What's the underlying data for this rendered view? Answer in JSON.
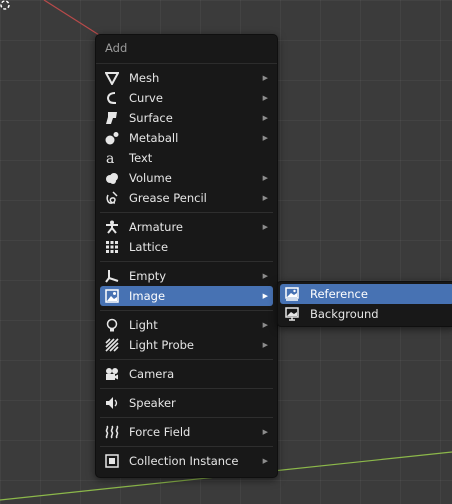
{
  "viewport": {
    "background_color": "#3b3b3b",
    "x_axis_color": "#b84a4a",
    "y_axis_color": "#8cb84a"
  },
  "add_menu": {
    "title": "Add",
    "items": [
      {
        "label": "Mesh",
        "icon": "mesh-icon",
        "submenu": true
      },
      {
        "label": "Curve",
        "icon": "curve-icon",
        "submenu": true
      },
      {
        "label": "Surface",
        "icon": "surface-icon",
        "submenu": true
      },
      {
        "label": "Metaball",
        "icon": "metaball-icon",
        "submenu": true
      },
      {
        "label": "Text",
        "icon": "text-icon",
        "submenu": false
      },
      {
        "label": "Volume",
        "icon": "volume-icon",
        "submenu": true
      },
      {
        "label": "Grease Pencil",
        "icon": "grease-pencil-icon",
        "submenu": true
      },
      {
        "label": "Armature",
        "icon": "armature-icon",
        "submenu": true
      },
      {
        "label": "Lattice",
        "icon": "lattice-icon",
        "submenu": false
      },
      {
        "label": "Empty",
        "icon": "empty-icon",
        "submenu": true
      },
      {
        "label": "Image",
        "icon": "image-icon",
        "submenu": true,
        "active": true
      },
      {
        "label": "Light",
        "icon": "light-icon",
        "submenu": true
      },
      {
        "label": "Light Probe",
        "icon": "light-probe-icon",
        "submenu": true
      },
      {
        "label": "Camera",
        "icon": "camera-icon",
        "submenu": false
      },
      {
        "label": "Speaker",
        "icon": "speaker-icon",
        "submenu": false
      },
      {
        "label": "Force Field",
        "icon": "force-field-icon",
        "submenu": true
      },
      {
        "label": "Collection Instance",
        "icon": "collection-instance-icon",
        "submenu": true
      }
    ]
  },
  "image_submenu": {
    "items": [
      {
        "label": "Reference",
        "icon": "reference-image-icon",
        "active": true
      },
      {
        "label": "Background",
        "icon": "background-image-icon",
        "active": false
      }
    ]
  },
  "colors": {
    "menu_bg": "#181818",
    "highlight": "#4772b3",
    "text": "#e6e6e6",
    "title_text": "#9a9a9a"
  },
  "submenu_arrow": "▶"
}
